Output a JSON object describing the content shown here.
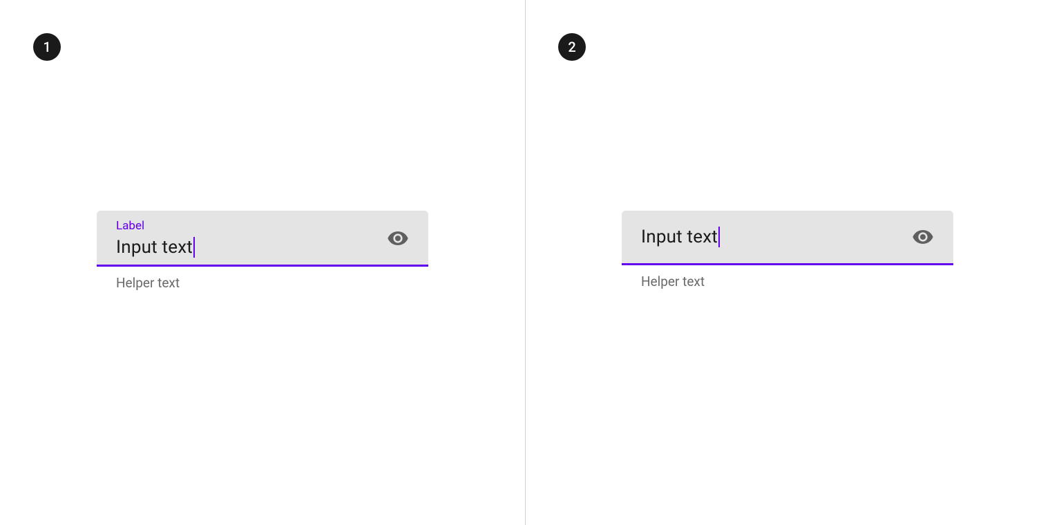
{
  "colors": {
    "accent": "#6200ee",
    "field_bg": "#e4e4e4",
    "badge_bg": "#1a1a1a",
    "helper": "#6a6a6a",
    "icon": "#5f5f5f"
  },
  "panels": {
    "a": {
      "badge": "1",
      "label": "Label",
      "input_value": "Input text",
      "helper": "Helper text",
      "icon": "visibility"
    },
    "b": {
      "badge": "2",
      "input_value": "Input text",
      "helper": "Helper text",
      "icon": "visibility"
    }
  }
}
